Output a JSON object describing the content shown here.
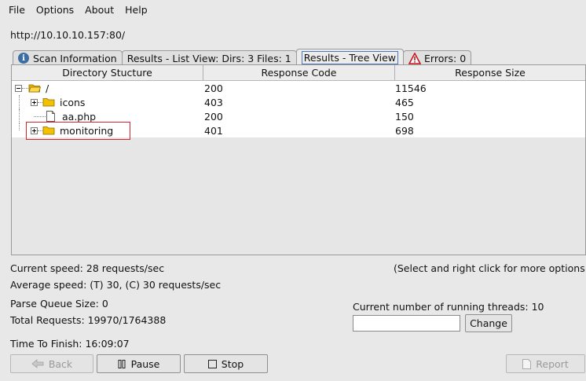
{
  "menu": [
    "File",
    "Options",
    "About",
    "Help"
  ],
  "target_url": "http://10.10.10.157:80/",
  "tabs": [
    {
      "label": "Scan Information",
      "icon": "info-icon"
    },
    {
      "label": "Results - List View: Dirs: 3 Files: 1"
    },
    {
      "label": "Results - Tree View",
      "active": true
    },
    {
      "label": "Errors: 0",
      "icon": "warning-icon"
    }
  ],
  "table": {
    "headers": [
      "Directory Stucture",
      "Response Code",
      "Response Size"
    ],
    "rows": [
      {
        "name": "/",
        "code": "200",
        "size": "11546",
        "type": "folder-open"
      },
      {
        "name": "icons",
        "code": "403",
        "size": "465",
        "type": "folder"
      },
      {
        "name": "aa.php",
        "code": "200",
        "size": "150",
        "type": "file"
      },
      {
        "name": "monitoring",
        "code": "401",
        "size": "698",
        "type": "folder"
      }
    ]
  },
  "stats": {
    "current_speed": "Current speed: 28 requests/sec",
    "hint": "(Select and right click for more options",
    "average_speed": "Average speed: (T) 30, (C) 30 requests/sec",
    "parse_queue": "Parse Queue Size: 0",
    "threads_label": "Current number of running threads: 10",
    "total_requests": "Total Requests: 19970/1764388",
    "time_to_finish": "Time To Finish: 16:09:07"
  },
  "buttons": {
    "change": "Change",
    "back": "Back",
    "pause": "Pause",
    "stop": "Stop",
    "report": "Report"
  },
  "colors": {
    "highlight_box": "#d6262b",
    "folder": "#f2c200",
    "info_icon": "#3b6ea5",
    "warning": "#c8161d"
  }
}
